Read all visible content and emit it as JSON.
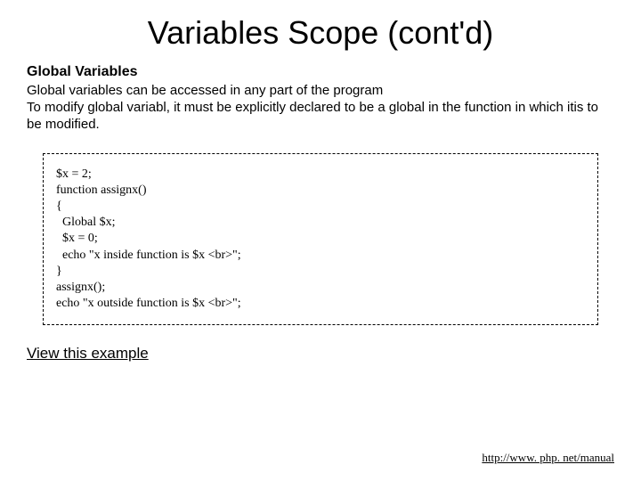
{
  "title": "Variables Scope (cont'd)",
  "subheading": "Global Variables",
  "body": "Global variables can be accessed in any part of the program\nTo modify global variabl, it must be explicitly declared to be a global in the function in which itis to be modified.",
  "code": "$x = 2;\nfunction assignx()\n{\n  Global $x;\n  $x = 0;\n  echo \"x inside function is $x <br>\";\n}\nassignx();\necho \"x outside function is $x <br>\";",
  "example_link": "View this example",
  "footer_link": "http://www. php. net/manual"
}
